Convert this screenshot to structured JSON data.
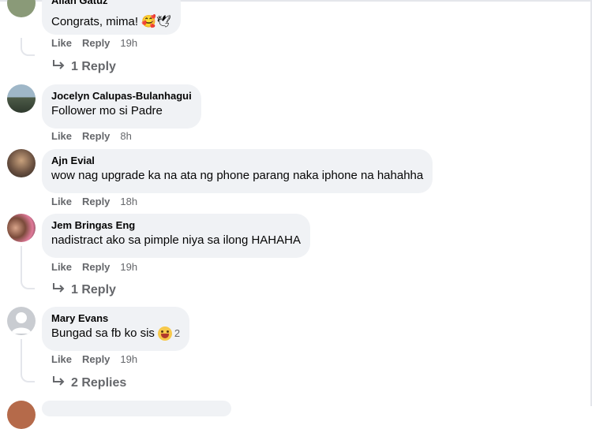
{
  "comments": [
    {
      "author": "Allan Gatuz",
      "text": "Congrats, mima! 🥰🕊",
      "like": "Like",
      "reply": "Reply",
      "time": "19h",
      "replies": "1 Reply"
    },
    {
      "author": "Jocelyn Calupas-Bulanhagui",
      "text": "Follower mo si Padre",
      "like": "Like",
      "reply": "Reply",
      "time": "8h"
    },
    {
      "author": "Ajn Evial",
      "text": "wow nag upgrade ka na ata ng phone parang naka iphone na hahahha",
      "like": "Like",
      "reply": "Reply",
      "time": "18h"
    },
    {
      "author": "Jem Bringas Eng",
      "text": "nadistract ako sa pimple niya sa ilong HAHAHA",
      "like": "Like",
      "reply": "Reply",
      "time": "19h",
      "replies": "1 Reply"
    },
    {
      "author": "Mary Evans",
      "text": "Bungad sa fb ko sis",
      "reaction_count": "2",
      "like": "Like",
      "reply": "Reply",
      "time": "19h",
      "replies": "2 Replies"
    }
  ],
  "colors": {
    "bubble": "#f0f2f5",
    "meta": "#65676b",
    "text": "#050505"
  }
}
